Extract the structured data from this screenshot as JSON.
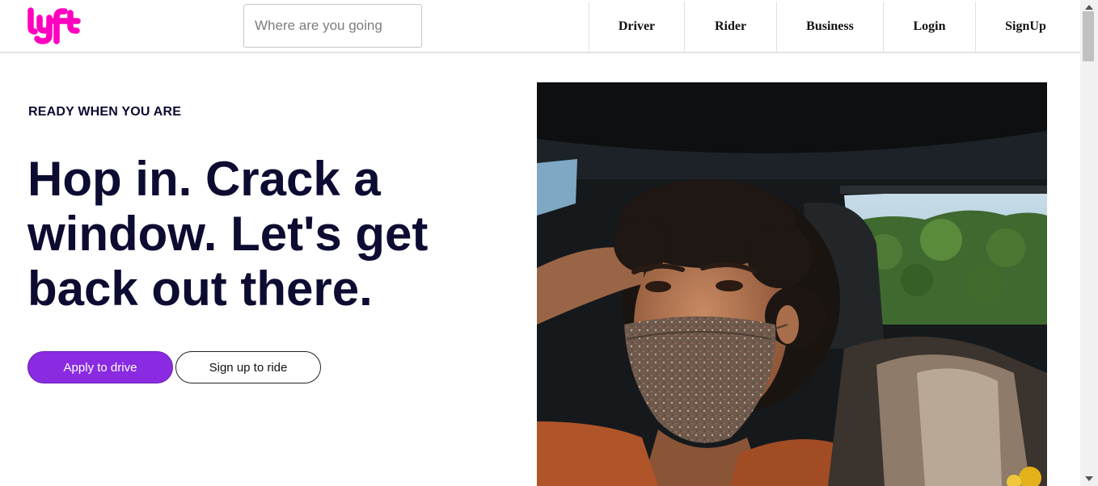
{
  "brand": {
    "name": "lyft",
    "color": "#ff00bf"
  },
  "header": {
    "search": {
      "placeholder": "Where are you going",
      "value": ""
    },
    "nav": [
      {
        "label": "Driver"
      },
      {
        "label": "Rider"
      },
      {
        "label": "Business"
      },
      {
        "label": "Login"
      },
      {
        "label": "SignUp"
      }
    ]
  },
  "hero": {
    "eyebrow": "READY WHEN YOU ARE",
    "headline": "Hop in. Crack a window. Let's get back out there.",
    "primary_button": "Apply to drive",
    "secondary_button": "Sign up to ride",
    "accent_color": "#8a2be2"
  },
  "icons": {
    "scroll_up": "chevron-up-icon",
    "scroll_down": "chevron-down-icon"
  }
}
